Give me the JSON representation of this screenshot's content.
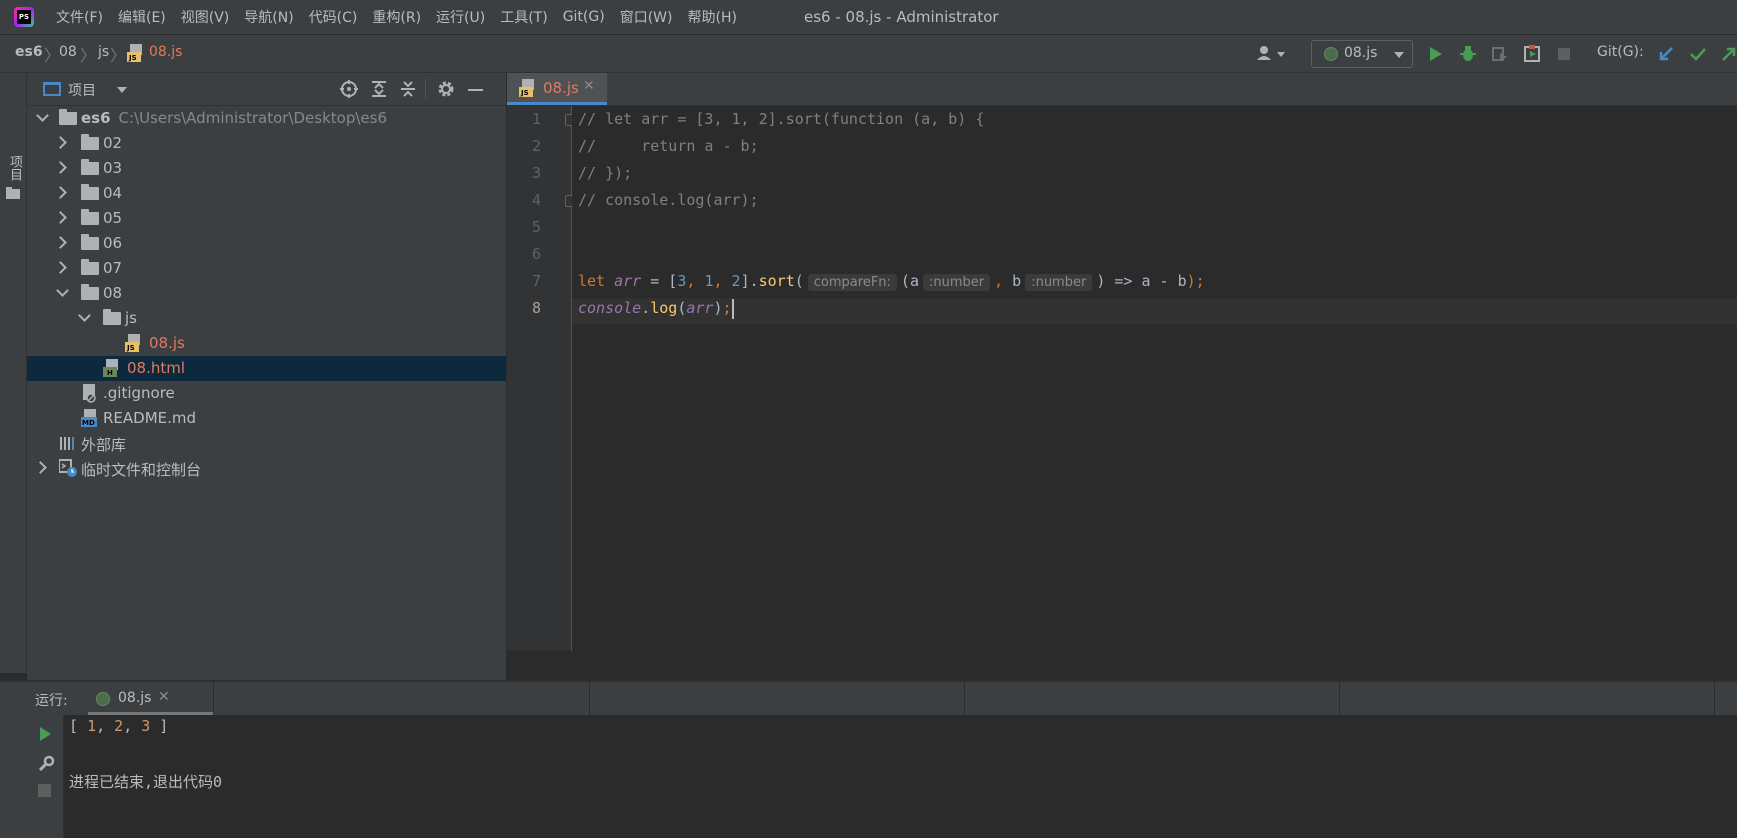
{
  "titlebar": {
    "menu": [
      "文件(F)",
      "编辑(E)",
      "视图(V)",
      "导航(N)",
      "代码(C)",
      "重构(R)",
      "运行(U)",
      "工具(T)",
      "Git(G)",
      "窗口(W)",
      "帮助(H)"
    ],
    "window_title": "es6 - 08.js - Administrator"
  },
  "navbar": {
    "breadcrumb": [
      "es6",
      "08",
      "js",
      "08.js"
    ],
    "run_config": "08.js",
    "git_label": "Git(G):"
  },
  "sidebar": {
    "label": "项目"
  },
  "project": {
    "header_label": "项目",
    "root_name": "es6",
    "root_path": "C:\\Users\\Administrator\\Desktop\\es6",
    "folders": [
      "02",
      "03",
      "04",
      "05",
      "06",
      "07",
      "08"
    ],
    "subfolder": "js",
    "js_file": "08.js",
    "html_file": "08.html",
    "gitignore": ".gitignore",
    "readme": "README.md",
    "ext_libs": "外部库",
    "scratches": "临时文件和控制台",
    "js_badge": "JS",
    "html_badge": "H",
    "md_badge": "MD"
  },
  "editor": {
    "tab_label": "08.js",
    "line_numbers": [
      "1",
      "2",
      "3",
      "4",
      "5",
      "6",
      "7",
      "8"
    ],
    "current_line": 8,
    "lines": [
      "// let arr = [3, 1, 2].sort(function (a, b) {",
      "//     return a - b;",
      "// });",
      "// console.log(arr);"
    ],
    "code7": {
      "kw_let": "let ",
      "var_arr": "arr",
      "eq": " = [",
      "n3": "3",
      "sep1": ", ",
      "n1": "1",
      "sep2": ", ",
      "n2": "2",
      "close": "].",
      "fn_sort": "sort",
      "open": "(",
      "hint_compare": "compareFn:",
      "param_a": "(a",
      "hint_num1": ":number",
      "comma": ",",
      "param_b": " b",
      "hint_num2": ":number",
      "rest": ") => a - b",
      "end": ");"
    },
    "code8": {
      "console": "console",
      "dot": ".",
      "fn_log": "log",
      "open": "(",
      "arg": "arr",
      "close": ")",
      "semi": ";"
    }
  },
  "run": {
    "label": "运行:",
    "tab_label": "08.js",
    "output": {
      "open": "[ ",
      "v1": "1",
      "sep1": ", ",
      "v2": "2",
      "sep2": ", ",
      "v3": "3",
      "close": " ]"
    },
    "exit_message": "进程已结束,退出代码0"
  },
  "colors": {
    "accent": "#4a88c7",
    "selection": "#0d293e",
    "run_green": "#499c54",
    "js_modified": "#e07a5f"
  }
}
